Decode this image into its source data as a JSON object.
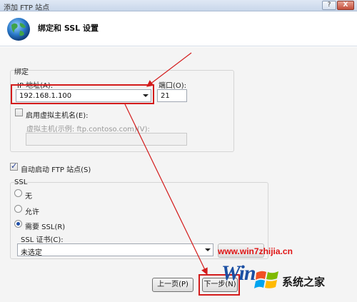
{
  "window": {
    "title": "添加 FTP 站点",
    "help_label": "?",
    "close_label": "X"
  },
  "header": {
    "title": "绑定和 SSL 设置"
  },
  "binding": {
    "group_label": "绑定",
    "ip_label": "IP 地址(A):",
    "ip_value": "192.168.1.100",
    "port_label": "端口(O):",
    "port_value": "21",
    "virtual_host_check_label": "启用虚拟主机名(E):",
    "virtual_host_label": "虚拟主机(示例: ftp.contoso.com)(V):",
    "virtual_host_value": ""
  },
  "autostart": {
    "label": "自动启动 FTP 站点(S)",
    "checked": true
  },
  "ssl": {
    "group_label": "SSL",
    "options": [
      "无",
      "允许",
      "需要 SSL(R)"
    ],
    "selected_index": 2,
    "cert_label": "SSL 证书(C):",
    "cert_value": "未选定"
  },
  "footer": {
    "prev_label": "上一页(P)",
    "next_label": "下一步(N)"
  },
  "watermark": {
    "url": "www.win7zhijia.cn",
    "logo_letters": "Win",
    "site_name": "系统之家"
  },
  "colors": {
    "highlight": "#d31b1b",
    "title_gradient_top": "#dfe8f4",
    "watermark_red": "#e01515"
  }
}
